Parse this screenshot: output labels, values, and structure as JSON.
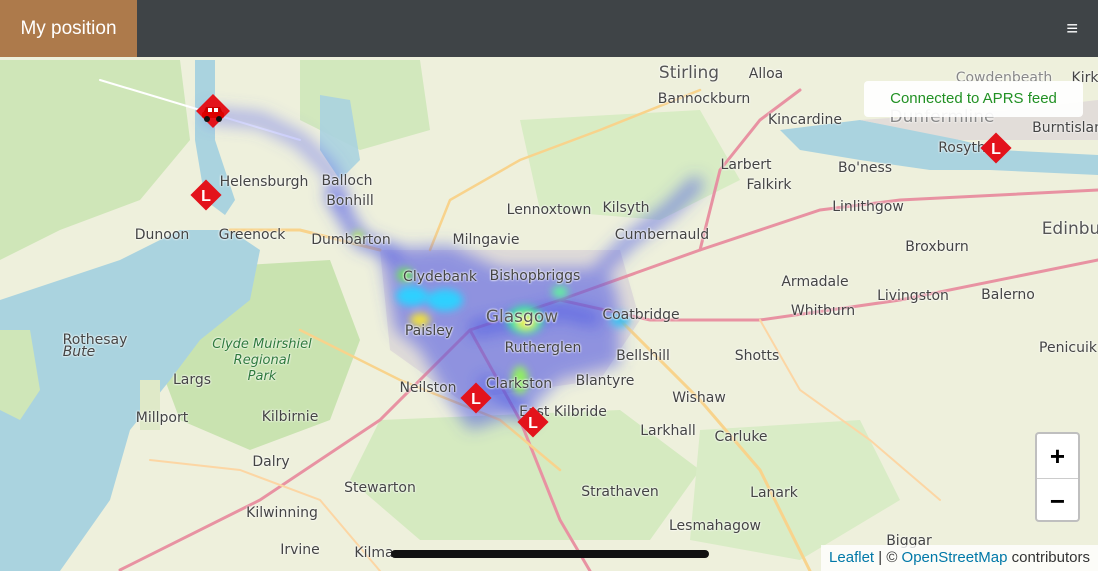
{
  "header": {
    "brand": "My position",
    "menu_icon": "hamburger-icon",
    "menu_glyph": "≡"
  },
  "status": {
    "text": "Connected to APRS feed",
    "color": "#229124"
  },
  "zoom": {
    "in_label": "+",
    "out_label": "−"
  },
  "attribution": {
    "leaflet": "Leaflet",
    "separator": " | © ",
    "osm": "OpenStreetMap",
    "suffix": " contributors"
  },
  "places": {
    "stirling": "Stirling",
    "alloa": "Alloa",
    "cowdenbeath": "Cowdenbeath",
    "kirk": "Kirk",
    "bannockburn": "Bannockburn",
    "kincardine": "Kincardine",
    "dunfermline": "Dunfermline",
    "burntisland": "Burntisland",
    "rosyth": "Rosyth",
    "larbert": "Larbert",
    "falkirk": "Falkirk",
    "boness": "Bo'ness",
    "helensburgh": "Helensburgh",
    "balloch": "Balloch",
    "bonhill": "Bonhill",
    "lennoxtown": "Lennoxtown",
    "kilsyth": "Kilsyth",
    "linlithgow": "Linlithgow",
    "dunoon": "Dunoon",
    "greenock": "Greenock",
    "dumbarton": "Dumbarton",
    "milngavie": "Milngavie",
    "cumbernauld": "Cumbernauld",
    "broxburn": "Broxburn",
    "edinburgh": "Edinbu",
    "clydebank": "Clydebank",
    "bishopbriggs": "Bishopbriggs",
    "armadale": "Armadale",
    "livingston": "Livingston",
    "balerno": "Balerno",
    "rothesay": "Rothesay",
    "bute": "Bute",
    "paisley": "Paisley",
    "glasgow": "Glasgow",
    "coatbridge": "Coatbridge",
    "whitburn": "Whitburn",
    "rutherglen": "Rutherglen",
    "bellshill": "Bellshill",
    "shotts": "Shotts",
    "penicuik": "Penicuik",
    "largs": "Largs",
    "neilston": "Neilston",
    "clarkston": "Clarkston",
    "blantyre": "Blantyre",
    "millport": "Millport",
    "kilbirnie": "Kilbirnie",
    "eastkilbride": "East Kilbride",
    "wishaw": "Wishaw",
    "larkhall": "Larkhall",
    "carluke": "Carluke",
    "dalry": "Dalry",
    "stewarton": "Stewarton",
    "strathaven": "Strathaven",
    "lanark": "Lanark",
    "kilwinning": "Kilwinning",
    "lesmahagow": "Lesmahagow",
    "irvine": "Irvine",
    "kilmarnock": "Kilma",
    "biggar": "Biggar",
    "park": "Clyde Muirshiel\nRegional\nPark"
  },
  "markers": [
    {
      "type": "vehicle",
      "icon": "car-icon"
    },
    {
      "type": "location",
      "icon": "l-marker-icon",
      "label": "L"
    }
  ]
}
